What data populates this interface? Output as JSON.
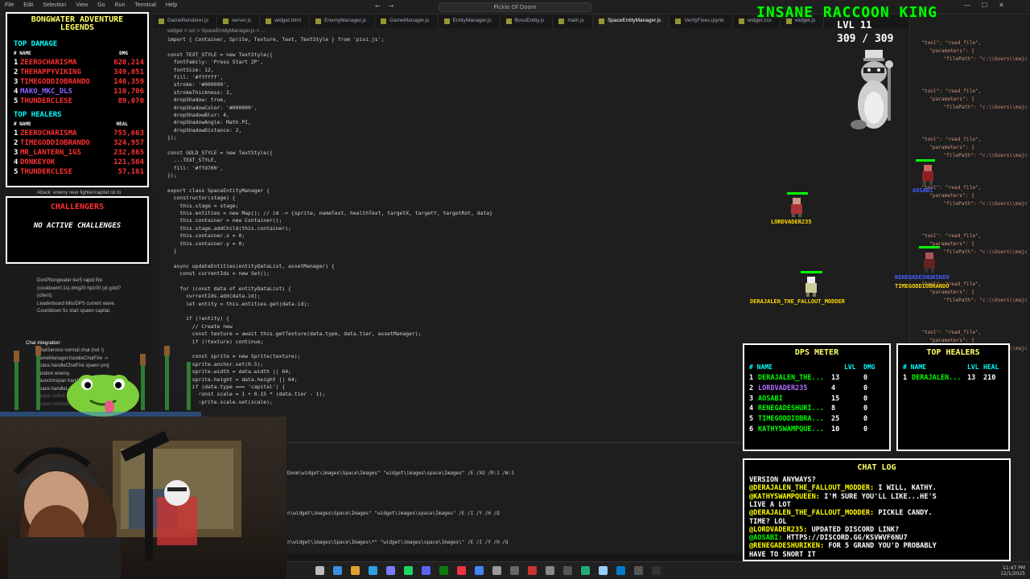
{
  "window": {
    "menu": [
      "File",
      "Edit",
      "Selection",
      "View",
      "Go",
      "Run",
      "Terminal",
      "Help"
    ],
    "search": "Pickle Of Doom",
    "controls": [
      "—",
      "☐",
      "✕"
    ]
  },
  "tabs": [
    "GameRenderer.js",
    "server.js",
    "widget.html",
    "EnemyManager.js",
    "GameManager.js",
    "EntityManager.js",
    "BossEntity.js",
    "main.js",
    "SpaceEntityManager.js",
    "VerifyFixes.ipynb",
    "widget.css",
    "widget.js"
  ],
  "active_tab": "SpaceEntityManager.js",
  "breadcrumb": "widget > src > SpaceEntityManager.js > ...",
  "code": [
    "import { Container, Sprite, Texture, Text, TextStyle } from 'pixi.js';",
    "",
    "const TEXT_STYLE = new TextStyle({",
    "  fontFamily: 'Press Start 2P',",
    "  fontSize: 12,",
    "  fill: '#ffffff',",
    "  stroke: '#000000',",
    "  strokeThickness: 2,",
    "  dropShadow: true,",
    "  dropShadowColor: '#000000',",
    "  dropShadowBlur: 4,",
    "  dropShadowAngle: Math.PI,",
    "  dropShadowDistance: 2,",
    "});",
    "",
    "const GOLD_STYLE = new TextStyle({",
    "  ...TEXT_STYLE,",
    "  fill: '#ffd700',",
    "});",
    "",
    "export class SpaceEntityManager {",
    "  constructor(stage) {",
    "    this.stage = stage;",
    "    this.entities = new Map(); // id -> {sprite, nameText, healthText, targetX, targetY, targetRot, data}",
    "    this.container = new Container();",
    "    this.stage.addChild(this.container);",
    "    this.container.x = 0;",
    "    this.container.y = 0;",
    "  }",
    "",
    "  async updateEntities(entityDataList, assetManager) {",
    "    const currentIds = new Set();",
    "",
    "    for (const data of entityDataList) {",
    "      currentIds.add(data.id);",
    "      let entity = this.entities.get(data.id);",
    "",
    "      if (!entity) {",
    "        // Create new",
    "        const texture = await this.getTexture(data.type, data.tier, assetManager);",
    "        if (!texture) continue;",
    "",
    "        const sprite = new Sprite(texture);",
    "        sprite.anchor.set(0.5);",
    "        sprite.width = data.width || 64;",
    "        sprite.height = data.height || 64;",
    "        if (data.type === 'capital') {",
    "          const scale = 1 + 0.15 * (data.tier - 1);",
    "          sprite.scale.set(scale);"
  ],
  "terminal": [
    "Doom\\widget\\images\\Space\\Images\" \"widget\\images\\space\\Images\" /E /XO /R:1 /W:1",
    "n\\widget\\images\\Space\\Images\" \"widget\\images\\space\\Images\" /E /I /Y /H /Q",
    "n\\widget\\images\\Space\\Images\\*\" \"widget\\images\\space\\Images\\\" /E /I /Y /H /Q"
  ],
  "copilot": [
    "Attack: enemy near fighter/capital rot to",
    "Update: random fly change vary 2%",
    "DonPflongwater tier5 rapid fire",
    "(cooldown0.1s) dmg20 hp100 (ot gold?",
    "(client).",
    "Leaderboard kills/DPS current wave.",
    "Countdown 5s start spawn capital.",
    "Chat integration:",
    "ChatService normal chat (not !)",
    "gameManager.handleChatFire ->",
    "space.handleChatFire spawn proj",
    "random enemy.",
    "!launch/repair handleCommand ->",
    "space.handleLaunch/Repair.",
    "Space switch gameMode='space' reset",
    "spawn countdown."
  ],
  "rightpanel": [
    "\"tool\": \"read_file\",",
    "\"parameters\": {",
    "  \"filePath\": \"c:\\\\Users\\\\majc"
  ],
  "leaderboard": {
    "title_line1": "BONGWATER ADVENTURE",
    "title_line2": "LEGENDS",
    "damage_title": "TOP DAMAGE",
    "healers_title": "TOP HEALERS",
    "col_name": "# NAME",
    "col_dmg": "DMG",
    "col_heal": "HEAL",
    "damage": [
      {
        "rank": "1",
        "name": "ZEEROCHARISMA",
        "value": "620,214"
      },
      {
        "rank": "2",
        "name": "THEHAPPYVIKING",
        "value": "349,051"
      },
      {
        "rank": "3",
        "name": "TIMEGODDIOBRANDO",
        "value": "140,359"
      },
      {
        "rank": "4",
        "name": "MAKO_MKC_DLS",
        "value": "110,706"
      },
      {
        "rank": "5",
        "name": "THUNDERCLESE",
        "value": "89,070"
      }
    ],
    "healers": [
      {
        "rank": "1",
        "name": "ZEEROCHARISMA",
        "value": "755,663"
      },
      {
        "rank": "2",
        "name": "TIMEGODDIOBRANDO",
        "value": "324,957"
      },
      {
        "rank": "3",
        "name": "MR_LANTERN_1GS",
        "value": "232,865"
      },
      {
        "rank": "4",
        "name": "DONKEYOK",
        "value": "121,564"
      },
      {
        "rank": "5",
        "name": "THUNDERCLESE",
        "value": "57,161"
      }
    ]
  },
  "challengers": {
    "title": "CHALLENGERS",
    "empty": "NO ACTIVE CHALLENGES"
  },
  "game": {
    "title": "INSANE RACCOON KING",
    "level": "LVL 11",
    "hp": "309 / 309",
    "players": [
      {
        "name": "LORDVADER235",
        "color": "#ffd700"
      },
      {
        "name": "AOSABI",
        "color": "#4060ff"
      },
      {
        "name": "DERAJALEN_THE_FALLOUT_MODDER",
        "color": "#ffd700"
      },
      {
        "name": "RENEGADESHURIKEN",
        "color": "#4060ff"
      },
      {
        "name": "TIMEGODDIOBRANDO",
        "color": "#ffd700"
      }
    ]
  },
  "dps_meter": {
    "title": "DPS METER",
    "headers": [
      "# NAME",
      "LVL",
      "DMG"
    ],
    "rows": [
      {
        "rank": "1",
        "name": "DERAJALEN_THE...",
        "lvl": "13",
        "dmg": "0"
      },
      {
        "rank": "2",
        "name": "LORDVADER235",
        "lvl": "4",
        "dmg": "0"
      },
      {
        "rank": "3",
        "name": "AOSABI",
        "lvl": "15",
        "dmg": "0"
      },
      {
        "rank": "4",
        "name": "RENEGADESHURI...",
        "lvl": "8",
        "dmg": "0"
      },
      {
        "rank": "5",
        "name": "TIMEGODDIOBRA...",
        "lvl": "25",
        "dmg": "0"
      },
      {
        "rank": "6",
        "name": "KATHYSWAMPQUE...",
        "lvl": "10",
        "dmg": "0"
      }
    ]
  },
  "top_healers": {
    "title": "TOP HEALERS",
    "headers": [
      "# NAME",
      "LVL",
      "HEAL"
    ],
    "rows": [
      {
        "rank": "1",
        "name": "DERAJALEN...",
        "lvl": "13",
        "heal": "210"
      }
    ]
  },
  "chat": {
    "title": "CHAT LOG",
    "lines": [
      {
        "user": "",
        "text": "VERSION ANYWAYS?"
      },
      {
        "user": "@DERAJALEN_THE_FALLOUT_MODDER:",
        "text": " I WILL, KATHY."
      },
      {
        "user": "@KATHYSWAMPQUEEN:",
        "text": " I'M SURE YOU'LL LIKE...HE'S"
      },
      {
        "user": "",
        "text": "LIVE A LOT"
      },
      {
        "user": "@DERAJALEN_THE_FALLOUT_MODDER:",
        "text": " PICKLE CANDY."
      },
      {
        "user": "",
        "text": "TIME? LOL"
      },
      {
        "user": "@LORDVADER235:",
        "text": " UPDATED DISCORD LINK?"
      },
      {
        "user": "@AOSABI:",
        "text": " HTTPS://DISCORD.GG/KSVWVF6NU7"
      },
      {
        "user": "@RENEGADESHURIKEN:",
        "text": " FOR 5 GRAND YOU'D PROBABLY"
      },
      {
        "user": "",
        "text": "HAVE TO SNORT IT"
      }
    ]
  },
  "taskbar": {
    "time": "11:47 PM",
    "date": "12/1/2025"
  },
  "colors": {
    "accent_green": "#00ff00",
    "title_yellow": "#ffff66",
    "overlay_border": "#ffffff",
    "editor_bg": "#1e1e1e"
  }
}
